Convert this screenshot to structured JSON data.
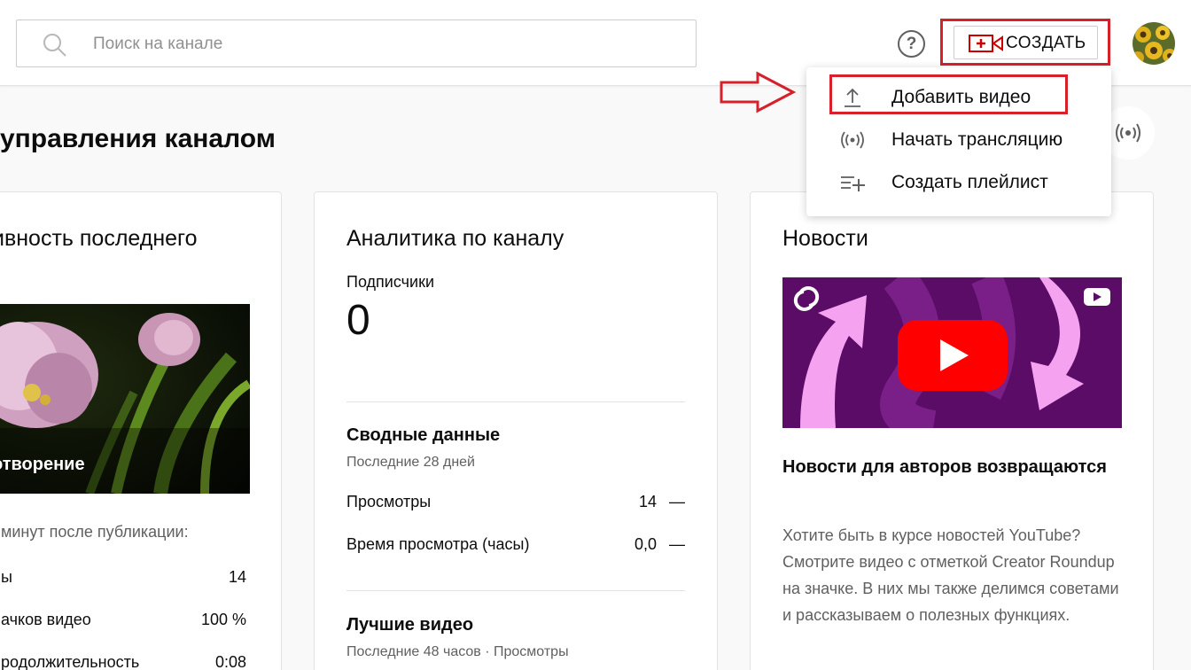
{
  "header": {
    "search_placeholder": "Поиск на канале",
    "help_symbol": "?",
    "create_label": "СОЗДАТЬ"
  },
  "page": {
    "title": "управления каналом"
  },
  "create_menu": {
    "items": [
      {
        "label": "Добавить видео",
        "icon": "upload-icon"
      },
      {
        "label": "Начать трансляцию",
        "icon": "live-icon"
      },
      {
        "label": "Создать плейлист",
        "icon": "playlist-add-icon"
      }
    ]
  },
  "latest_video_card": {
    "title": "ивность последнего",
    "thumbnail_label": "отворение",
    "subtitle": "минут после публикации:",
    "rows": [
      {
        "label": "ы",
        "value": "14"
      },
      {
        "label": "ачков видео",
        "value": "100 %"
      },
      {
        "label": "родолжительность",
        "value": "0:08"
      }
    ]
  },
  "analytics_card": {
    "title": "Аналитика по каналу",
    "subscribers_label": "Подписчики",
    "subscribers_value": "0",
    "summary_title": "Сводные данные",
    "summary_period": "Последние 28 дней",
    "summary_rows": [
      {
        "label": "Просмотры",
        "value": "14",
        "trend": "—"
      },
      {
        "label": "Время просмотра (часы)",
        "value": "0,0",
        "trend": "—"
      }
    ],
    "top_videos_title": "Лучшие видео",
    "top_videos_period": "Последние 48 часов · Просмотры"
  },
  "news_card": {
    "title": "Новости",
    "headline": "Новости для авторов возвращаются",
    "body": "Хотите быть в курсе новостей YouTube? Смотрите видео с отметкой Creator Roundup на значке. В них мы также делимся советами и рассказываем о полезных функциях."
  },
  "colors": {
    "accent_red": "#d6202a",
    "youtube_red": "#ff0000",
    "news_purple": "#5a0c66",
    "news_pink": "#f5a3f0"
  }
}
